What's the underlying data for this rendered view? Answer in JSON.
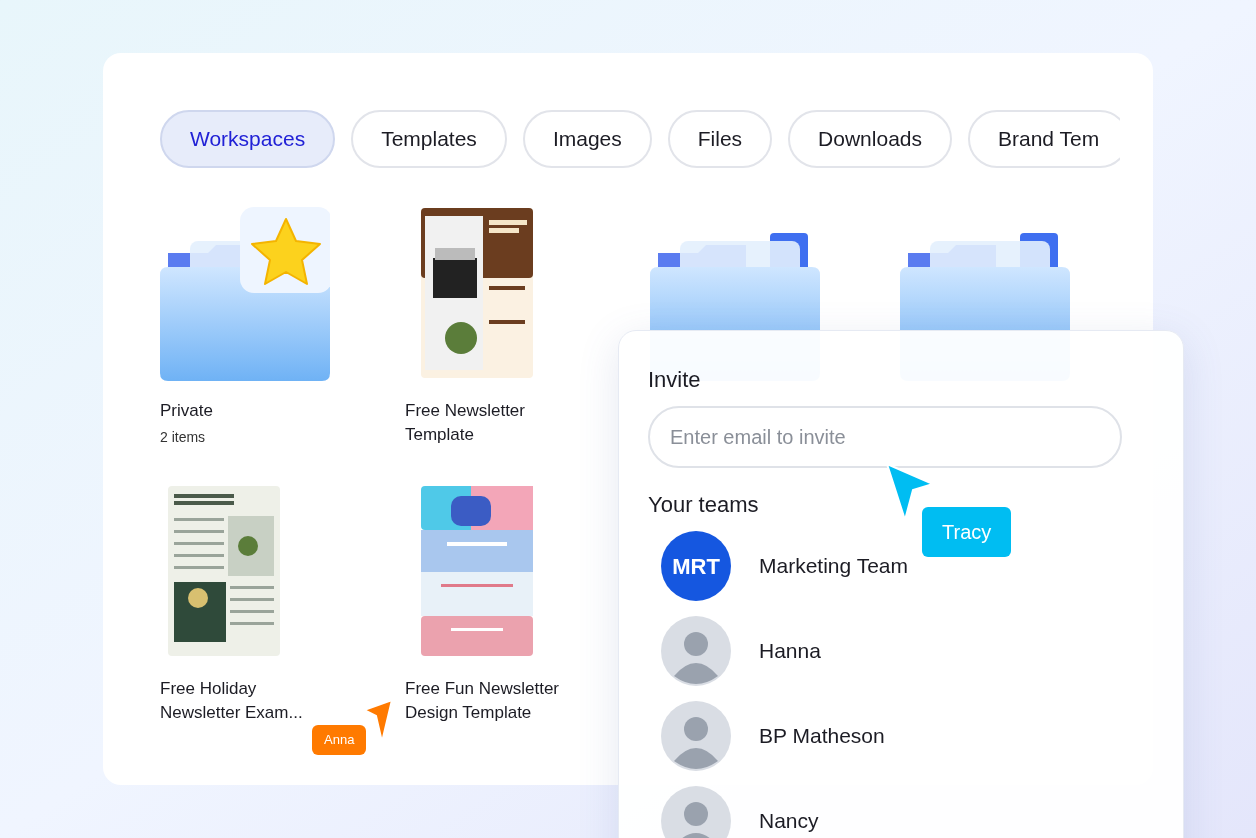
{
  "tabs": [
    {
      "label": "Workspaces",
      "selected": true
    },
    {
      "label": "Templates",
      "selected": false
    },
    {
      "label": "Images",
      "selected": false
    },
    {
      "label": "Files",
      "selected": false
    },
    {
      "label": "Downloads",
      "selected": false
    },
    {
      "label": "Brand Tem",
      "selected": false
    }
  ],
  "items": [
    {
      "kind": "folder",
      "starred": true,
      "title": "Private",
      "subtitle": "2 items"
    },
    {
      "kind": "newsletter",
      "title": "Free Newsletter Template"
    },
    {
      "kind": "folder",
      "starred": false
    },
    {
      "kind": "folder",
      "starred": false
    },
    {
      "kind": "holiday",
      "title": "Free Holiday Newsletter Exam..."
    },
    {
      "kind": "magazine",
      "title": "Free Fun Newsletter Design Template"
    }
  ],
  "invite": {
    "title": "Invite",
    "placeholder": "Enter email to invite",
    "teams_title": "Your teams",
    "teams": [
      {
        "kind": "initials",
        "initials": "MRT",
        "name": "Marketing Team"
      },
      {
        "kind": "photo",
        "name": "Hanna"
      },
      {
        "kind": "photo",
        "name": "BP Matheson"
      },
      {
        "kind": "photo",
        "name": "Nancy"
      }
    ]
  },
  "cursors": [
    {
      "name": "Tracy",
      "color": "#00bdf2"
    },
    {
      "name": "Anna",
      "color": "#ff7a00"
    }
  ]
}
